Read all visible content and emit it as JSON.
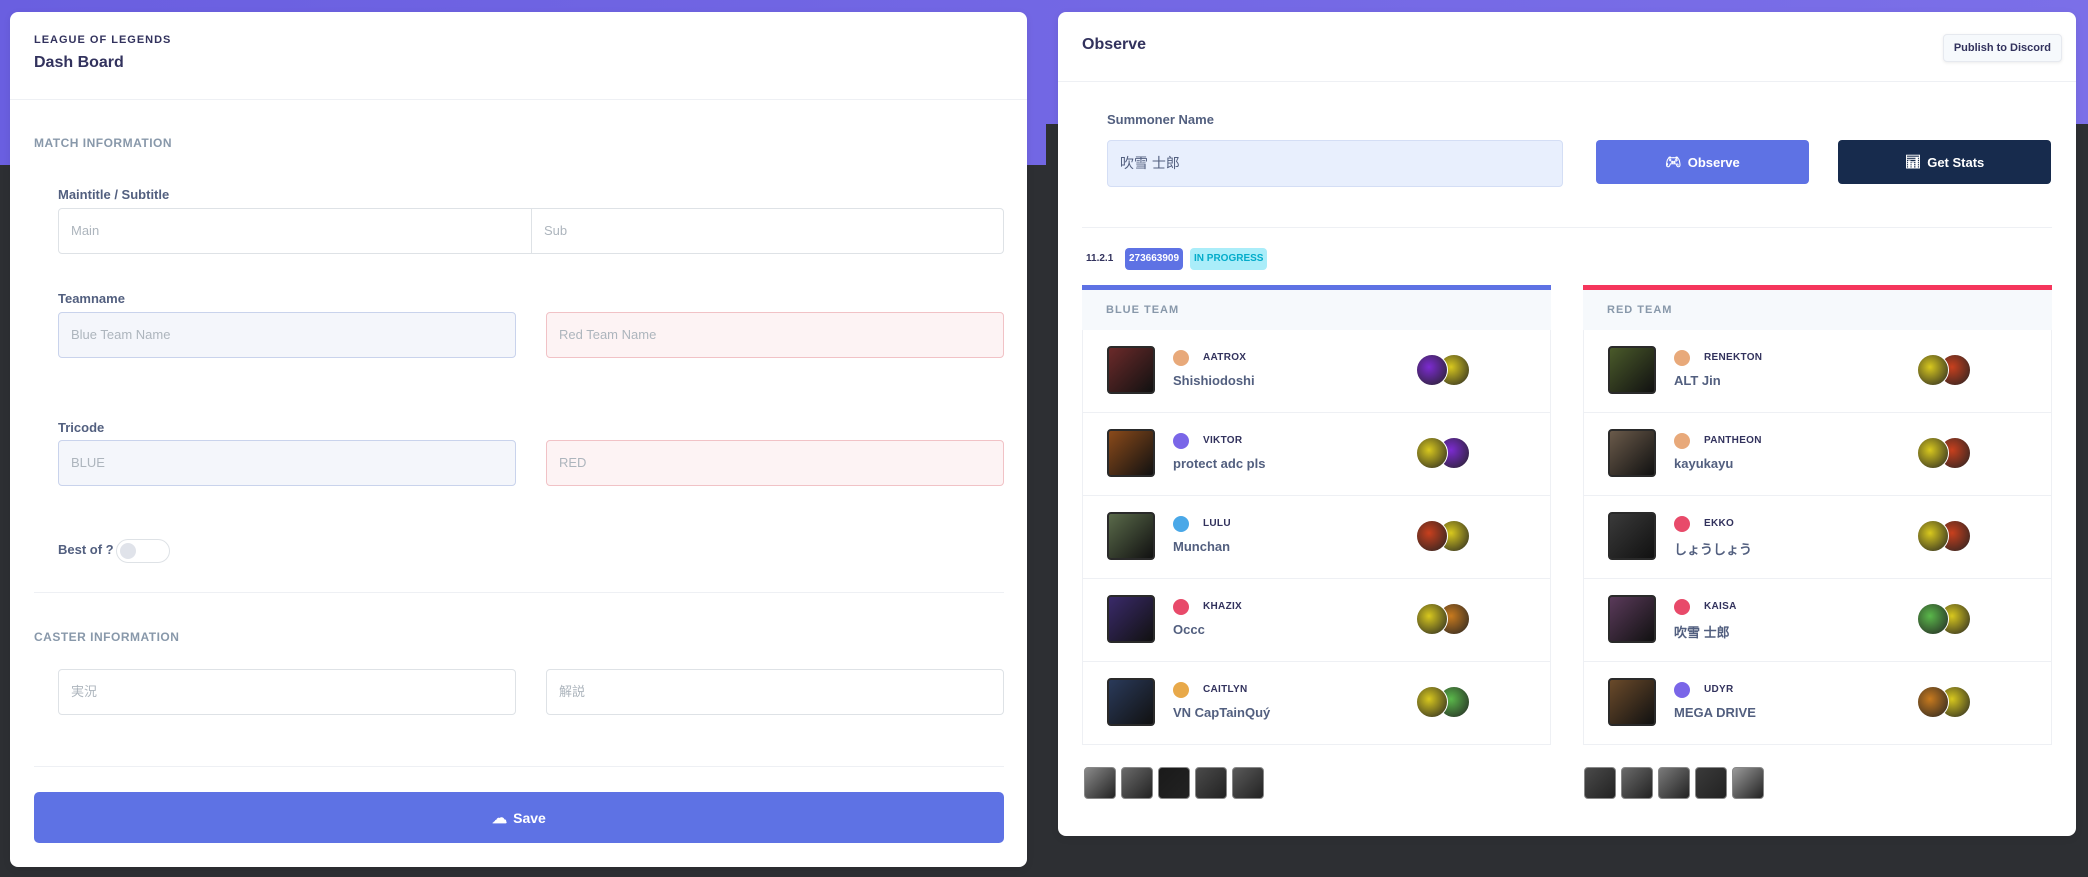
{
  "dashboard": {
    "eyebrow": "LEAGUE OF LEGENDS",
    "title": "Dash Board",
    "match_section": "MATCH INFORMATION",
    "maintitle_label": "Maintitle / Subtitle",
    "main_placeholder": "Main",
    "sub_placeholder": "Sub",
    "teamname_label": "Teamname",
    "blue_team_placeholder": "Blue Team Name",
    "red_team_placeholder": "Red Team Name",
    "tricode_label": "Tricode",
    "blue_tricode_placeholder": "BLUE",
    "red_tricode_placeholder": "RED",
    "bestof_label": "Best of ?",
    "caster_section": "CASTER INFORMATION",
    "caster1_placeholder": "実況",
    "caster2_placeholder": "解説",
    "save_label": "Save",
    "save_icon": "cloud-upload-icon"
  },
  "observe": {
    "title": "Observe",
    "publish_label": "Publish to Discord",
    "summoner_label": "Summoner Name",
    "summoner_value": "吹雪 士郎",
    "observe_label": "Observe",
    "observe_icon": "gamepad-icon",
    "stats_label": "Get Stats",
    "stats_icon": "bar-chart-icon",
    "version": "11.2.1",
    "game_id": "273663909",
    "status": "IN PROGRESS",
    "blue_team": {
      "label": "BLUE TEAM",
      "players": [
        {
          "champion": "AATROX",
          "name": "Shishiodoshi",
          "role_color": "#e8a97a",
          "portrait": "#6b2a2a",
          "spells": [
            "#7c2bd1",
            "#d8c81e"
          ]
        },
        {
          "champion": "VIKTOR",
          "name": "protect adc pls",
          "role_color": "#7a66e8",
          "portrait": "#8a4a1a",
          "spells": [
            "#d8c81e",
            "#7c2bd1"
          ]
        },
        {
          "champion": "LULU",
          "name": "Munchan",
          "role_color": "#4aa8e8",
          "portrait": "#5a6a4a",
          "spells": [
            "#c8401e",
            "#d8c81e"
          ]
        },
        {
          "champion": "KHAZIX",
          "name": "Occc",
          "role_color": "#e84a6a",
          "portrait": "#3a2a6a",
          "spells": [
            "#d8c81e",
            "#c87a1e"
          ]
        },
        {
          "champion": "CAITLYN",
          "name": "VN CapTainQuý",
          "role_color": "#e8a94a",
          "portrait": "#2a3a5a",
          "spells": [
            "#d8c81e",
            "#5ab84a"
          ]
        }
      ],
      "bans": [
        "#8a8a8a",
        "#6a6a6a",
        "#1a1a1a",
        "#4a4a4a",
        "#5a5a5a"
      ]
    },
    "red_team": {
      "label": "RED TEAM",
      "players": [
        {
          "champion": "RENEKTON",
          "name": "ALT Jin",
          "role_color": "#e8a97a",
          "portrait": "#4a5a2a",
          "spells": [
            "#d8c81e",
            "#c8401e"
          ]
        },
        {
          "champion": "PANTHEON",
          "name": "kayukayu",
          "role_color": "#e8a97a",
          "portrait": "#6a5a4a",
          "spells": [
            "#d8c81e",
            "#c8401e"
          ]
        },
        {
          "champion": "EKKO",
          "name": "しょうしょう",
          "role_color": "#e84a6a",
          "portrait": "#3a3a3a",
          "spells": [
            "#d8c81e",
            "#c8401e"
          ]
        },
        {
          "champion": "KAISA",
          "name": "吹雪 士郎",
          "role_color": "#e84a6a",
          "portrait": "#5a3a5a",
          "spells": [
            "#5ab84a",
            "#d8c81e"
          ]
        },
        {
          "champion": "UDYR",
          "name": "MEGA DRIVE",
          "role_color": "#7a66e8",
          "portrait": "#6a4a2a",
          "spells": [
            "#c87a1e",
            "#d8c81e"
          ]
        }
      ],
      "bans": [
        "#4a4a4a",
        "#6a6a6a",
        "#7a7a7a",
        "#3a3a3a",
        "#9a9a9a"
      ]
    }
  }
}
